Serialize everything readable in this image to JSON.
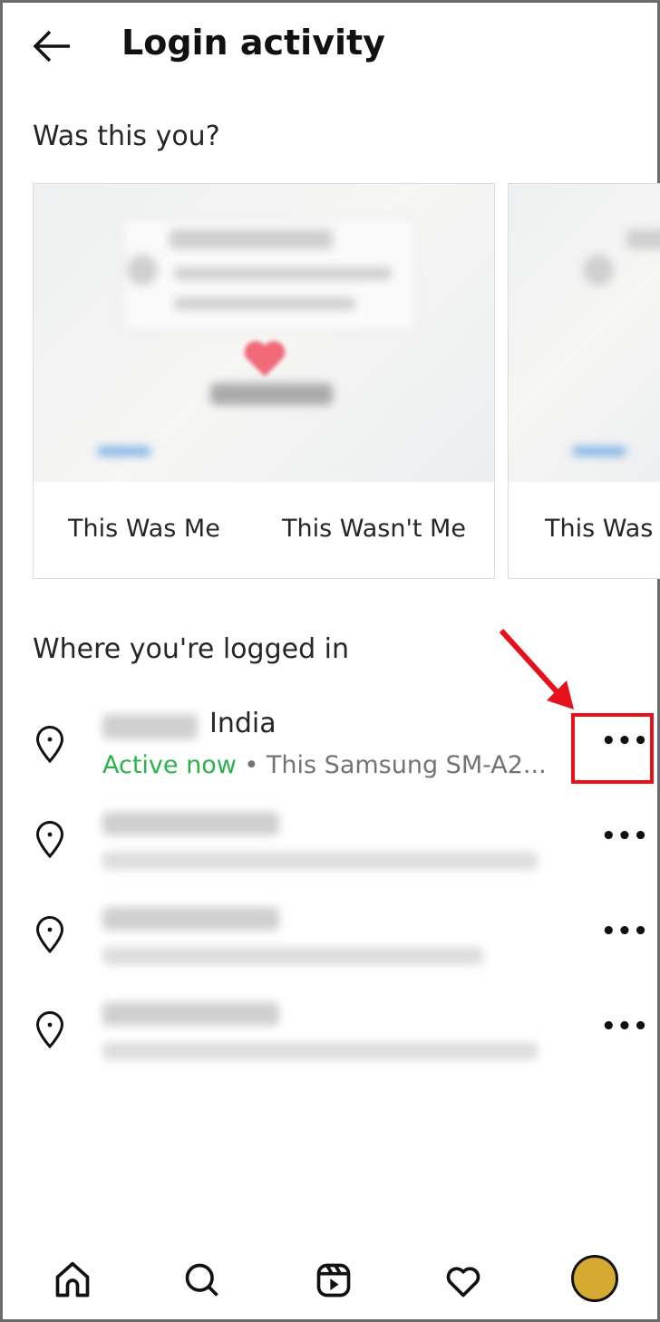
{
  "header": {
    "title": "Login activity",
    "back_icon": "arrow-left-icon"
  },
  "was_this_you": {
    "heading": "Was this you?",
    "cards": [
      {
        "confirm_label": "This Was Me",
        "deny_label": "This Wasn't Me"
      },
      {
        "confirm_label": "This Was"
      }
    ]
  },
  "logged_in": {
    "heading": "Where you're logged in",
    "sessions": [
      {
        "location": "India",
        "status": "Active now",
        "device": "• This Samsung SM-A2...",
        "status_color": "#2bb24c"
      },
      {
        "location": "",
        "status": "",
        "device": ""
      },
      {
        "location": "",
        "status": "",
        "device": ""
      },
      {
        "location": "",
        "status": "",
        "device": ""
      }
    ],
    "more_label": "•••"
  },
  "annotation": {
    "color": "#e8101a"
  },
  "bottom_nav": [
    "home-icon",
    "search-icon",
    "reels-icon",
    "heart-icon",
    "profile-avatar"
  ]
}
